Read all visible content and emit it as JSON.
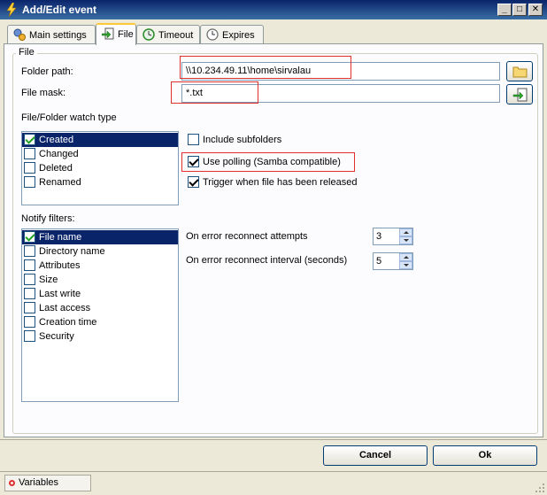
{
  "window": {
    "title": "Add/Edit event"
  },
  "tabs": [
    {
      "label": "Main settings",
      "icon": "gears-icon"
    },
    {
      "label": "File",
      "icon": "file-arrow-icon"
    },
    {
      "label": "Timeout",
      "icon": "refresh-clock-icon"
    },
    {
      "label": "Expires",
      "icon": "clock-icon"
    }
  ],
  "active_tab": "File",
  "file_group": {
    "legend": "File",
    "folder_path_label": "Folder path:",
    "folder_path_value": "\\\\10.234.49.11\\home\\sirvalau",
    "file_mask_label": "File mask:",
    "file_mask_value": "*.txt"
  },
  "watch_type": {
    "label": "File/Folder watch type",
    "items": [
      {
        "label": "Created",
        "checked": true,
        "selected": true
      },
      {
        "label": "Changed",
        "checked": false,
        "selected": false
      },
      {
        "label": "Deleted",
        "checked": false,
        "selected": false
      },
      {
        "label": "Renamed",
        "checked": false,
        "selected": false
      }
    ]
  },
  "options": [
    {
      "label": "Include subfolders",
      "checked": false
    },
    {
      "label": "Use polling (Samba compatible)",
      "checked": true
    },
    {
      "label": "Trigger when file has been released",
      "checked": true
    }
  ],
  "notify_filters": {
    "label": "Notify filters:",
    "items": [
      {
        "label": "File name",
        "checked": true,
        "selected": true
      },
      {
        "label": "Directory name",
        "checked": false,
        "selected": false
      },
      {
        "label": "Attributes",
        "checked": false,
        "selected": false
      },
      {
        "label": "Size",
        "checked": false,
        "selected": false
      },
      {
        "label": "Last write",
        "checked": false,
        "selected": false
      },
      {
        "label": "Last access",
        "checked": false,
        "selected": false
      },
      {
        "label": "Creation time",
        "checked": false,
        "selected": false
      },
      {
        "label": "Security",
        "checked": false,
        "selected": false
      }
    ]
  },
  "reconnect": {
    "attempts_label": "On error reconnect attempts",
    "attempts_value": "3",
    "interval_label": "On error reconnect interval (seconds)",
    "interval_value": "5"
  },
  "buttons": {
    "cancel": "Cancel",
    "ok": "Ok"
  },
  "statusbar": {
    "variables_label": "Variables"
  },
  "colors": {
    "highlight": "#e0302c",
    "selection": "#0a246a",
    "check": "#21a121"
  }
}
